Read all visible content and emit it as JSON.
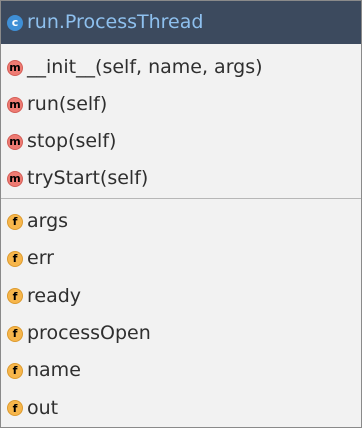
{
  "header": {
    "icon": "class-icon",
    "icon_glyph": "c",
    "title": "run.ProcessThread"
  },
  "methods": {
    "icon": "method-icon",
    "icon_glyph": "m",
    "items": [
      "__init__(self, name, args)",
      "run(self)",
      "stop(self)",
      "tryStart(self)"
    ]
  },
  "fields": {
    "icon": "field-icon",
    "icon_glyph": "f",
    "items": [
      "args",
      "err",
      "ready",
      "processOpen",
      "name",
      "out"
    ]
  },
  "colors": {
    "header_background": "#3c4a5e",
    "header_text": "#8ec0ee",
    "panel_background": "#f2f2f2",
    "method_badge": "#ee7b73",
    "field_badge": "#f7b64b",
    "class_badge": "#3f8fd6"
  }
}
